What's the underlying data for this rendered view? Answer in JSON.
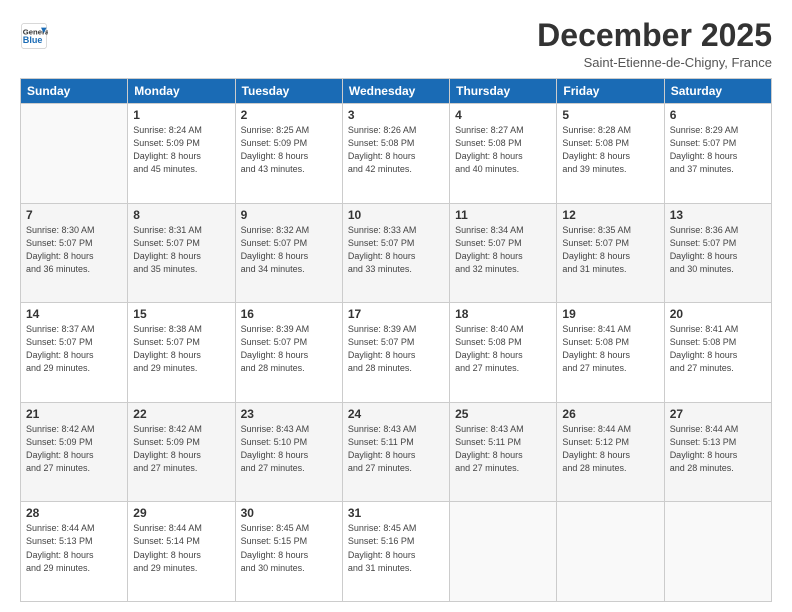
{
  "logo": {
    "line1": "General",
    "line2": "Blue"
  },
  "title": "December 2025",
  "subtitle": "Saint-Etienne-de-Chigny, France",
  "weekdays": [
    "Sunday",
    "Monday",
    "Tuesday",
    "Wednesday",
    "Thursday",
    "Friday",
    "Saturday"
  ],
  "weeks": [
    [
      {
        "day": "",
        "info": ""
      },
      {
        "day": "1",
        "info": "Sunrise: 8:24 AM\nSunset: 5:09 PM\nDaylight: 8 hours\nand 45 minutes."
      },
      {
        "day": "2",
        "info": "Sunrise: 8:25 AM\nSunset: 5:09 PM\nDaylight: 8 hours\nand 43 minutes."
      },
      {
        "day": "3",
        "info": "Sunrise: 8:26 AM\nSunset: 5:08 PM\nDaylight: 8 hours\nand 42 minutes."
      },
      {
        "day": "4",
        "info": "Sunrise: 8:27 AM\nSunset: 5:08 PM\nDaylight: 8 hours\nand 40 minutes."
      },
      {
        "day": "5",
        "info": "Sunrise: 8:28 AM\nSunset: 5:08 PM\nDaylight: 8 hours\nand 39 minutes."
      },
      {
        "day": "6",
        "info": "Sunrise: 8:29 AM\nSunset: 5:07 PM\nDaylight: 8 hours\nand 37 minutes."
      }
    ],
    [
      {
        "day": "7",
        "info": "Sunrise: 8:30 AM\nSunset: 5:07 PM\nDaylight: 8 hours\nand 36 minutes."
      },
      {
        "day": "8",
        "info": "Sunrise: 8:31 AM\nSunset: 5:07 PM\nDaylight: 8 hours\nand 35 minutes."
      },
      {
        "day": "9",
        "info": "Sunrise: 8:32 AM\nSunset: 5:07 PM\nDaylight: 8 hours\nand 34 minutes."
      },
      {
        "day": "10",
        "info": "Sunrise: 8:33 AM\nSunset: 5:07 PM\nDaylight: 8 hours\nand 33 minutes."
      },
      {
        "day": "11",
        "info": "Sunrise: 8:34 AM\nSunset: 5:07 PM\nDaylight: 8 hours\nand 32 minutes."
      },
      {
        "day": "12",
        "info": "Sunrise: 8:35 AM\nSunset: 5:07 PM\nDaylight: 8 hours\nand 31 minutes."
      },
      {
        "day": "13",
        "info": "Sunrise: 8:36 AM\nSunset: 5:07 PM\nDaylight: 8 hours\nand 30 minutes."
      }
    ],
    [
      {
        "day": "14",
        "info": "Sunrise: 8:37 AM\nSunset: 5:07 PM\nDaylight: 8 hours\nand 29 minutes."
      },
      {
        "day": "15",
        "info": "Sunrise: 8:38 AM\nSunset: 5:07 PM\nDaylight: 8 hours\nand 29 minutes."
      },
      {
        "day": "16",
        "info": "Sunrise: 8:39 AM\nSunset: 5:07 PM\nDaylight: 8 hours\nand 28 minutes."
      },
      {
        "day": "17",
        "info": "Sunrise: 8:39 AM\nSunset: 5:07 PM\nDaylight: 8 hours\nand 28 minutes."
      },
      {
        "day": "18",
        "info": "Sunrise: 8:40 AM\nSunset: 5:08 PM\nDaylight: 8 hours\nand 27 minutes."
      },
      {
        "day": "19",
        "info": "Sunrise: 8:41 AM\nSunset: 5:08 PM\nDaylight: 8 hours\nand 27 minutes."
      },
      {
        "day": "20",
        "info": "Sunrise: 8:41 AM\nSunset: 5:08 PM\nDaylight: 8 hours\nand 27 minutes."
      }
    ],
    [
      {
        "day": "21",
        "info": "Sunrise: 8:42 AM\nSunset: 5:09 PM\nDaylight: 8 hours\nand 27 minutes."
      },
      {
        "day": "22",
        "info": "Sunrise: 8:42 AM\nSunset: 5:09 PM\nDaylight: 8 hours\nand 27 minutes."
      },
      {
        "day": "23",
        "info": "Sunrise: 8:43 AM\nSunset: 5:10 PM\nDaylight: 8 hours\nand 27 minutes."
      },
      {
        "day": "24",
        "info": "Sunrise: 8:43 AM\nSunset: 5:11 PM\nDaylight: 8 hours\nand 27 minutes."
      },
      {
        "day": "25",
        "info": "Sunrise: 8:43 AM\nSunset: 5:11 PM\nDaylight: 8 hours\nand 27 minutes."
      },
      {
        "day": "26",
        "info": "Sunrise: 8:44 AM\nSunset: 5:12 PM\nDaylight: 8 hours\nand 28 minutes."
      },
      {
        "day": "27",
        "info": "Sunrise: 8:44 AM\nSunset: 5:13 PM\nDaylight: 8 hours\nand 28 minutes."
      }
    ],
    [
      {
        "day": "28",
        "info": "Sunrise: 8:44 AM\nSunset: 5:13 PM\nDaylight: 8 hours\nand 29 minutes."
      },
      {
        "day": "29",
        "info": "Sunrise: 8:44 AM\nSunset: 5:14 PM\nDaylight: 8 hours\nand 29 minutes."
      },
      {
        "day": "30",
        "info": "Sunrise: 8:45 AM\nSunset: 5:15 PM\nDaylight: 8 hours\nand 30 minutes."
      },
      {
        "day": "31",
        "info": "Sunrise: 8:45 AM\nSunset: 5:16 PM\nDaylight: 8 hours\nand 31 minutes."
      },
      {
        "day": "",
        "info": ""
      },
      {
        "day": "",
        "info": ""
      },
      {
        "day": "",
        "info": ""
      }
    ]
  ]
}
